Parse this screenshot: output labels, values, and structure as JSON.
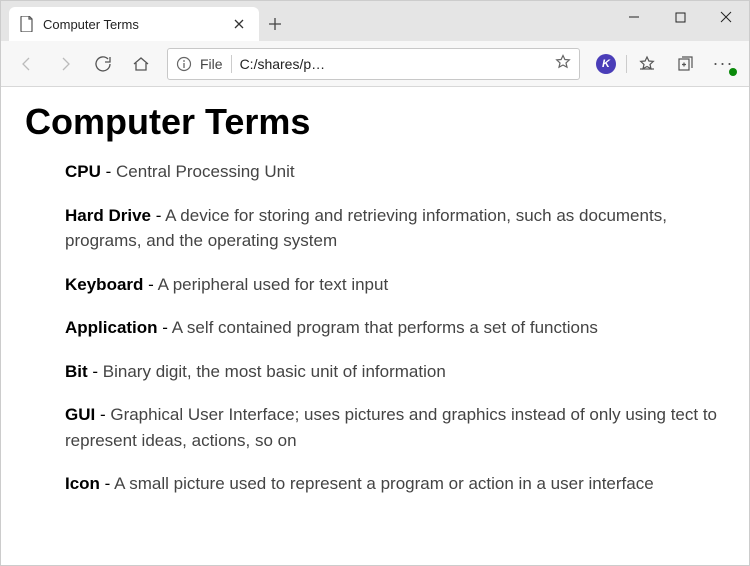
{
  "window": {
    "tab_title": "Computer Terms"
  },
  "address": {
    "scheme": "File",
    "path": "C:/shares/p…"
  },
  "extension": {
    "letter": "K"
  },
  "content": {
    "heading": "Computer Terms",
    "terms": [
      {
        "term": "CPU",
        "def": "Central Processing Unit"
      },
      {
        "term": "Hard Drive",
        "def": "A device for storing and retrieving information, such as documents, programs, and the operating system"
      },
      {
        "term": "Keyboard",
        "def": "A peripheral used for text input"
      },
      {
        "term": "Application",
        "def": "A self contained program that performs a set of functions"
      },
      {
        "term": "Bit",
        "def": "Binary digit, the most basic unit of information"
      },
      {
        "term": "GUI",
        "def": "Graphical User Interface; uses pictures and graphics instead of only using tect to represent ideas, actions, so on"
      },
      {
        "term": "Icon",
        "def": "A small picture used to represent a program or action in a user interface"
      }
    ]
  }
}
